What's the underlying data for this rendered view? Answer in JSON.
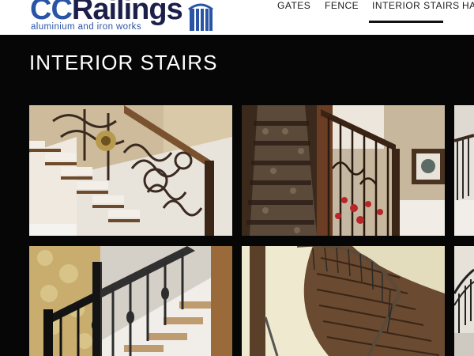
{
  "brand": {
    "name_prefix": "CC",
    "name_suffix": "Railings",
    "tagline": "aluminium and iron works",
    "color_primary": "#2a54a5",
    "color_dark": "#1d1f4b"
  },
  "nav": {
    "items": [
      {
        "label": "GATES",
        "active": false
      },
      {
        "label": "FENCE",
        "active": false
      },
      {
        "label": "INTERIOR STAIRS",
        "active": true
      },
      {
        "label": "HA",
        "active": false
      }
    ]
  },
  "page": {
    "title": "INTERIOR STAIRS"
  }
}
